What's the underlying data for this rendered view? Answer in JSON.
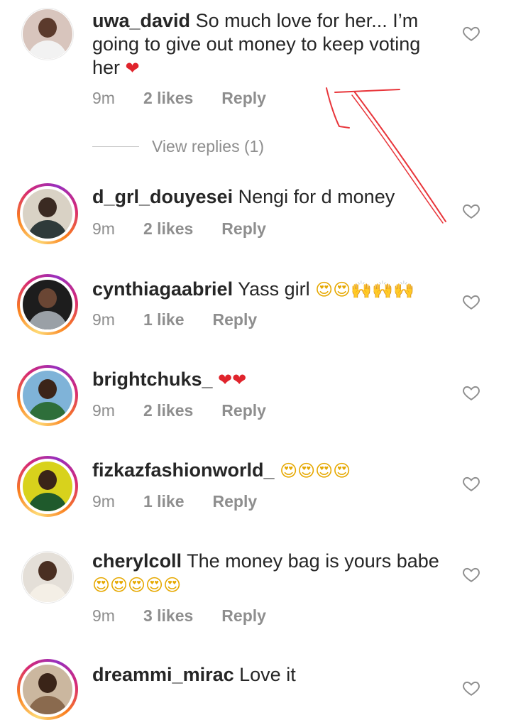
{
  "comments": [
    {
      "username": "uwa_david",
      "text": "So much love for her... I’m going to give out money to keep voting her",
      "emoji": "❤",
      "time": "9m",
      "likes": "2 likes",
      "reply": "Reply",
      "view_replies": "View replies (1)"
    },
    {
      "username": "d_grl_douyesei",
      "text": "Nengi for d money",
      "emoji": "",
      "time": "9m",
      "likes": "2 likes",
      "reply": "Reply"
    },
    {
      "username": "cynthiagaabriel",
      "text": "Yass girl",
      "emoji": "😍😍🙌🙌🙌",
      "time": "9m",
      "likes": "1 like",
      "reply": "Reply"
    },
    {
      "username": "brightchuks_",
      "text": "",
      "emoji": "❤❤",
      "time": "9m",
      "likes": "2 likes",
      "reply": "Reply"
    },
    {
      "username": "fizkazfashionworld_",
      "text": "",
      "emoji": "😍😍😍😍",
      "time": "9m",
      "likes": "1 like",
      "reply": "Reply"
    },
    {
      "username": "cherylcoll",
      "text": "The money bag is yours babe",
      "emoji": "😍😍😍😍😍",
      "time": "9m",
      "likes": "3 likes",
      "reply": "Reply"
    },
    {
      "username": "dreammi_mirac",
      "text": "Love it",
      "emoji": "",
      "time": "",
      "likes": "",
      "reply": ""
    }
  ],
  "colors": {
    "accent_heart": "#e0242c",
    "meta_gray": "#8e8e8e",
    "annotation_red": "#e8353a"
  },
  "icons": {
    "like": "heart-outline-icon"
  }
}
